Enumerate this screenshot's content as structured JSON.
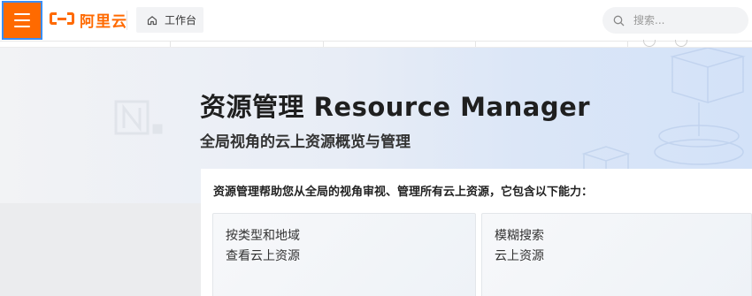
{
  "header": {
    "logo_text": "阿里云",
    "workbench_label": "工作台",
    "search_placeholder": "搜索..."
  },
  "hero": {
    "title": "资源管理 Resource Manager",
    "subtitle": "全局视角的云上资源概览与管理"
  },
  "card": {
    "description": "资源管理帮助您从全局的视角审视、管理所有云上资源，它包含以下能力：",
    "features": [
      {
        "line1": "按类型和地域",
        "line2": "查看云上资源"
      },
      {
        "line1": "模糊搜索",
        "line2": "云上资源"
      }
    ]
  },
  "colors": {
    "accent": "#ff6a00",
    "focus_border": "#3a8ef6"
  }
}
